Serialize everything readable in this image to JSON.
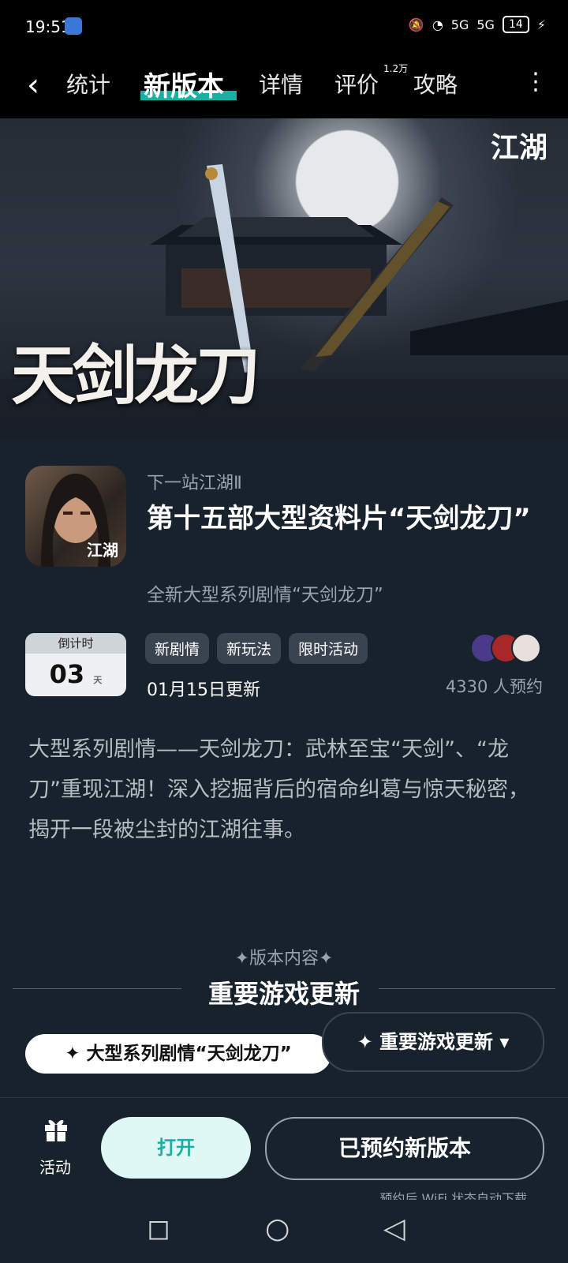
{
  "status_bar": {
    "time": "19:51",
    "network1": "5G",
    "network2": "5G",
    "battery": "14"
  },
  "nav": {
    "tabs": [
      {
        "label": "统计"
      },
      {
        "label": "新版本"
      },
      {
        "label": "详情"
      },
      {
        "label": "评价"
      },
      {
        "label": "攻略"
      }
    ],
    "review_count": "1.2万"
  },
  "banner": {
    "title": "天剑龙刀",
    "logo": "江湖"
  },
  "game": {
    "icon_text": "江湖",
    "subtitle": "下一站江湖Ⅱ",
    "title": "第十五部大型资料片“天剑龙刀”",
    "description": "全新大型系列剧情“天剑龙刀”"
  },
  "countdown": {
    "label": "倒计时",
    "value": "03",
    "unit": "天"
  },
  "tags": [
    "新剧情",
    "新玩法",
    "限时活动"
  ],
  "update_date": "01月15日更新",
  "reservations": "4330 人预约",
  "intro": "大型系列剧情——天剑龙刀：武林至宝“天剑”、“龙刀”重现江湖！深入挖掘背后的宿命纠葛与惊天秘密，揭开一段被尘封的江湖往事。",
  "section": {
    "label": "✦版本内容✦",
    "title": "重要游戏更新"
  },
  "pills": {
    "left": "✦ 大型系列剧情“天剑龙刀”",
    "right": "✦ 重要游戏更新 ▾"
  },
  "bottom": {
    "activity_label": "活动",
    "open_label": "打开",
    "reserved_label": "已预约新版本",
    "wifi_note": "预约后 WiFi 状态自动下载"
  },
  "colors": {
    "accent": "#16b1a2",
    "background": "#18222c"
  }
}
